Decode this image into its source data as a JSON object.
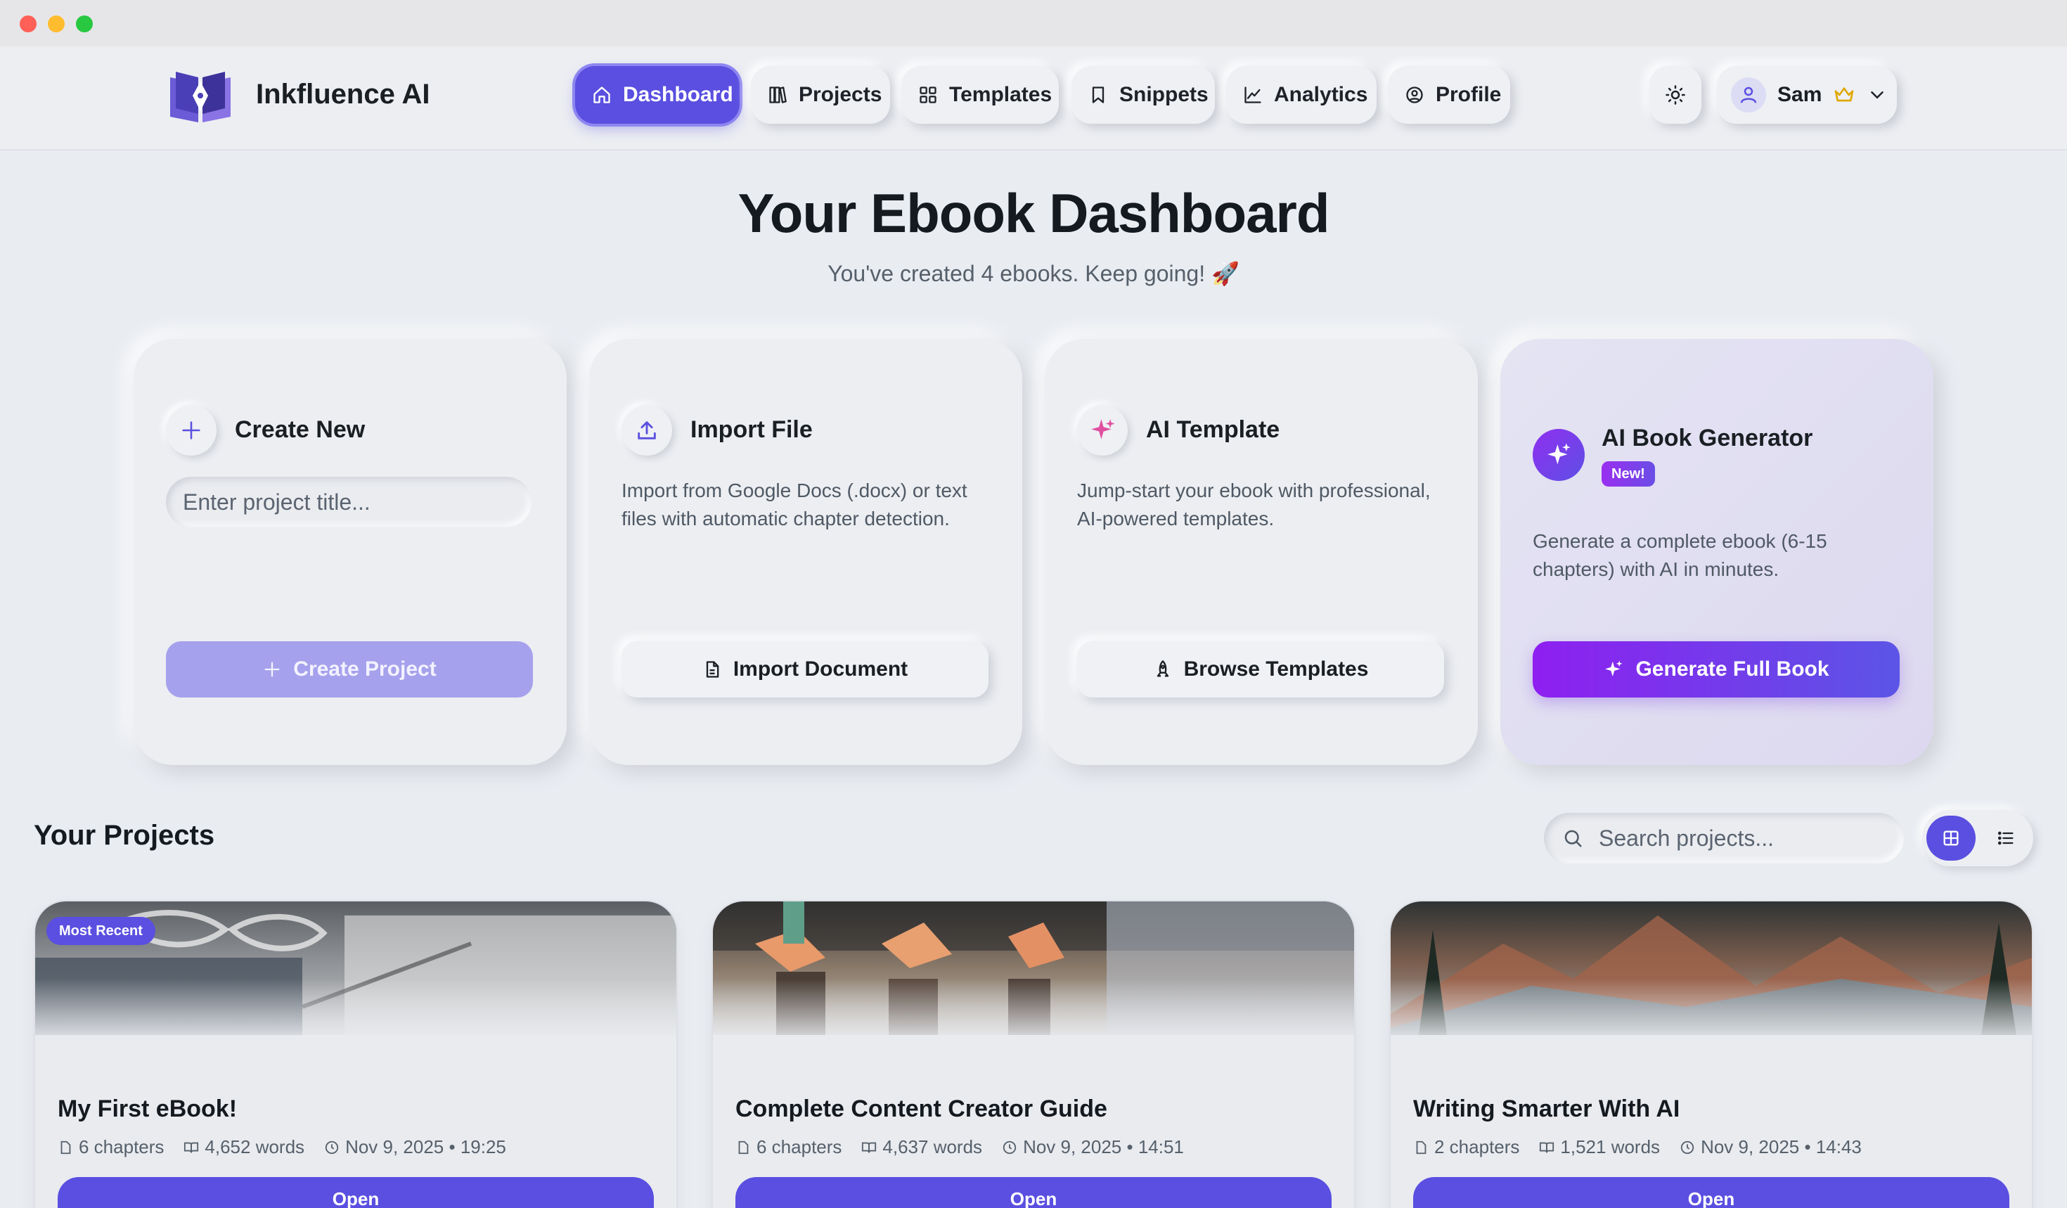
{
  "window": {
    "controls": [
      "close",
      "minimize",
      "maximize"
    ]
  },
  "header": {
    "brand": "Inkfluence AI",
    "nav": [
      {
        "label": "Dashboard",
        "icon": "home-icon",
        "active": true
      },
      {
        "label": "Projects",
        "icon": "books-icon"
      },
      {
        "label": "Templates",
        "icon": "grid-icon"
      },
      {
        "label": "Snippets",
        "icon": "bookmark-icon"
      },
      {
        "label": "Analytics",
        "icon": "chart-icon"
      },
      {
        "label": "Profile",
        "icon": "user-circle-icon"
      }
    ],
    "theme_icon": "sun-icon",
    "user": {
      "name": "Sam",
      "badge_icon": "crown-icon",
      "menu_icon": "chevron-down-icon"
    }
  },
  "hero": {
    "title": "Your Ebook Dashboard",
    "subtitle": "You've created 4 ebooks. Keep going! 🚀"
  },
  "actions": {
    "create": {
      "title": "Create New",
      "input_placeholder": "Enter project title...",
      "button": "Create Project"
    },
    "import": {
      "title": "Import File",
      "description": "Import from Google Docs (.docx) or text files with automatic chapter detection.",
      "button": "Import Document"
    },
    "template": {
      "title": "AI Template",
      "description": "Jump-start your ebook with professional, AI-powered templates.",
      "button": "Browse Templates"
    },
    "generator": {
      "title": "AI Book Generator",
      "badge": "New!",
      "description": "Generate a complete ebook (6-15 chapters) with AI in minutes.",
      "button": "Generate Full Book"
    }
  },
  "projects": {
    "title": "Your Projects",
    "search_placeholder": "Search projects...",
    "view_mode": "grid",
    "items": [
      {
        "badge": "Most Recent",
        "title": "My First eBook!",
        "chapters": "6 chapters",
        "words": "4,652 words",
        "date": "Nov 9, 2025 • 19:25",
        "open": "Open"
      },
      {
        "title": "Complete Content Creator Guide",
        "chapters": "6 chapters",
        "words": "4,637 words",
        "date": "Nov 9, 2025 • 14:51",
        "open": "Open"
      },
      {
        "title": "Writing Smarter With AI",
        "chapters": "2 chapters",
        "words": "1,521 words",
        "date": "Nov 9, 2025 • 14:43",
        "open": "Open"
      }
    ]
  },
  "colors": {
    "accent": "#5a4fe0",
    "background": "#e9ecf1",
    "generate_gradient_start": "#8e1ff0",
    "generate_gradient_end": "#5b55e6"
  }
}
